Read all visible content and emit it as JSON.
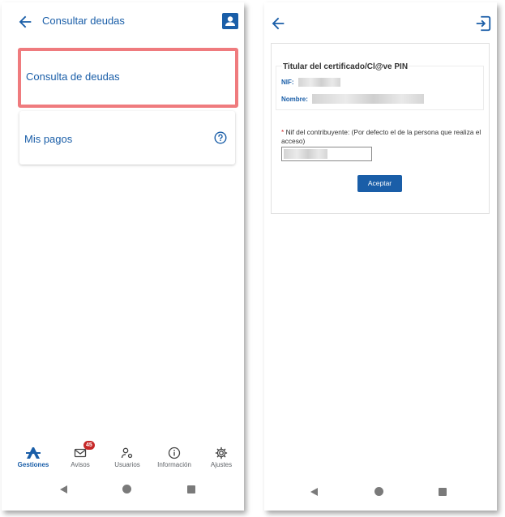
{
  "left": {
    "appbar": {
      "title": "Consultar deudas"
    },
    "cards": [
      {
        "label": "Consulta de deudas"
      },
      {
        "label": "Mis pagos"
      }
    ],
    "bottom_nav": [
      {
        "label": "Gestiones",
        "icon": "gestiones-logo-icon",
        "active": true
      },
      {
        "label": "Avisos",
        "icon": "mail-icon",
        "badge": "45"
      },
      {
        "label": "Usuarios",
        "icon": "users-settings-icon"
      },
      {
        "label": "Información",
        "icon": "info-icon"
      },
      {
        "label": "Ajustes",
        "icon": "gear-icon"
      }
    ]
  },
  "right": {
    "panel": {
      "title": "Titular del certificado/Cl@ve PIN",
      "nif_label": "NIF:",
      "nombre_label": "Nombre:",
      "required_mark": "*",
      "nif_field_label": "Nif del contribuyente: (Por defecto el de la persona que realiza el acceso)",
      "accept_label": "Aceptar"
    }
  },
  "colors": {
    "primary": "#1a5ea8",
    "highlight_border": "#ef7b7e",
    "badge": "#c62828"
  }
}
